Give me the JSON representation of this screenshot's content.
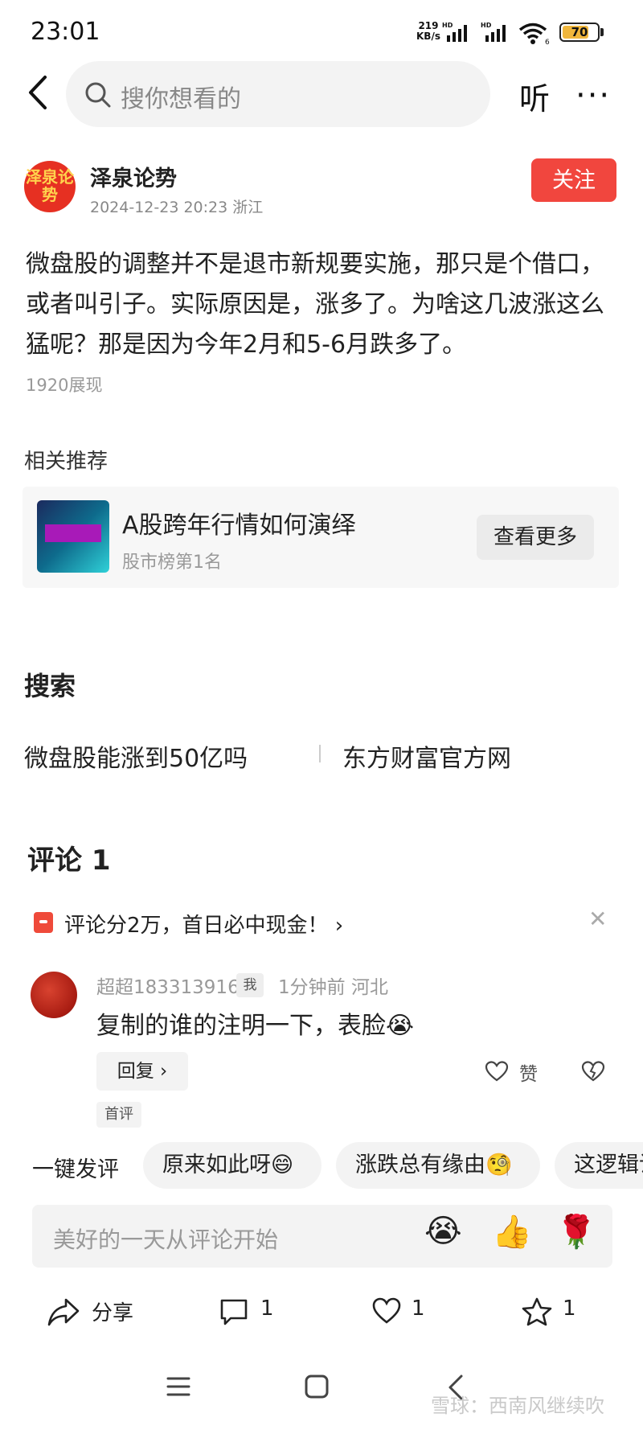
{
  "status_bar": {
    "time": "23:01",
    "net_speed_value": "219",
    "net_speed_unit": "KB/s",
    "hd_label_1": "HD",
    "hd_label_2": "HD",
    "wifi_badge": "6",
    "battery": "70"
  },
  "top_nav": {
    "search_placeholder": "搜你想看的",
    "listen_label": "听",
    "more_label": "···"
  },
  "post": {
    "author_avatar_text": "泽泉论势",
    "author_name": "泽泉论势",
    "meta": "2024-12-23 20:23  浙江",
    "follow_label": "关注",
    "body": "微盘股的调整并不是退市新规要实施，那只是个借口，或者叫引子。实际原因是，涨多了。为啥这几波涨这么猛呢？那是因为今年2月和5-6月跌多了。",
    "views": "1920展现"
  },
  "related": {
    "title": "相关推荐",
    "card_title": "A股跨年行情如何演绎",
    "card_sub": "股市榜第1名",
    "more_label": "查看更多"
  },
  "search_section": {
    "title": "搜索",
    "links": [
      "微盘股能涨到50亿吗",
      "东方财富官方网"
    ]
  },
  "comments": {
    "title": "评论 1",
    "promo_text": "评论分2万，首日必中现金！ ›",
    "items": [
      {
        "user": "超超183313916",
        "badge": "我",
        "meta": "1分钟前   河北",
        "text": "复制的谁的注明一下，表脸😭",
        "reply_label": "回复 ›",
        "like_label": "赞",
        "first_badge": "首评"
      }
    ],
    "quick_label": "一键发评",
    "quick_replies": [
      "原来如此呀😄",
      "涨跌总有缘由🧐",
      "这逻辑说"
    ],
    "input_placeholder": "美好的一天从评论开始",
    "emojis": [
      "😭",
      "👍",
      "🌹"
    ]
  },
  "bottom_bar": {
    "share_label": "分享",
    "comment_count": "1",
    "like_count": "1",
    "fav_count": "1"
  },
  "watermark": "雪球：西南风继续吹",
  "colors": {
    "accent": "#f1463e",
    "muted": "#999999",
    "chip_bg": "#f3f3f3"
  }
}
